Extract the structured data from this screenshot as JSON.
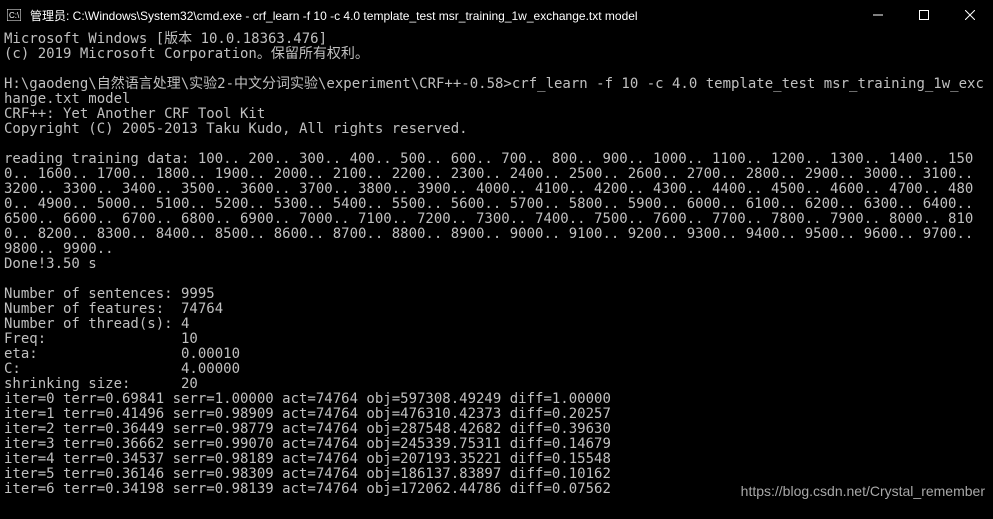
{
  "window": {
    "title": "管理员: C:\\Windows\\System32\\cmd.exe - crf_learn  -f 10 -c 4.0 template_test msr_training_1w_exchange.txt model"
  },
  "terminal": {
    "header": "Microsoft Windows [版本 10.0.18363.476]\n(c) 2019 Microsoft Corporation。保留所有权利。\n\nH:\\gaodeng\\自然语言处理\\实验2-中文分词实验\\experiment\\CRF++-0.58>crf_learn -f 10 -c 4.0 template_test msr_training_1w_exchange.txt model\nCRF++: Yet Another CRF Tool Kit\nCopyright (C) 2005-2013 Taku Kudo, All rights reserved.\n\nreading training data: 100.. 200.. 300.. 400.. 500.. 600.. 700.. 800.. 900.. 1000.. 1100.. 1200.. 1300.. 1400.. 1500.. 1600.. 1700.. 1800.. 1900.. 2000.. 2100.. 2200.. 2300.. 2400.. 2500.. 2600.. 2700.. 2800.. 2900.. 3000.. 3100.. 3200.. 3300.. 3400.. 3500.. 3600.. 3700.. 3800.. 3900.. 4000.. 4100.. 4200.. 4300.. 4400.. 4500.. 4600.. 4700.. 4800.. 4900.. 5000.. 5100.. 5200.. 5300.. 5400.. 5500.. 5600.. 5700.. 5800.. 5900.. 6000.. 6100.. 6200.. 6300.. 6400.. 6500.. 6600.. 6700.. 6800.. 6900.. 7000.. 7100.. 7200.. 7300.. 7400.. 7500.. 7600.. 7700.. 7800.. 7900.. 8000.. 8100.. 8200.. 8300.. 8400.. 8500.. 8600.. 8700.. 8800.. 8900.. 9000.. 9100.. 9200.. 9300.. 9400.. 9500.. 9600.. 9700.. 9800.. 9900..\nDone!3.50 s\n",
    "stats": "Number of sentences: 9995\nNumber of features:  74764\nNumber of thread(s): 4\nFreq:                10\neta:                 0.00010\nC:                   4.00000\nshrinking size:      20",
    "iters": "iter=0 terr=0.69841 serr=1.00000 act=74764 obj=597308.49249 diff=1.00000\niter=1 terr=0.41496 serr=0.98909 act=74764 obj=476310.42373 diff=0.20257\niter=2 terr=0.36449 serr=0.98779 act=74764 obj=287548.42682 diff=0.39630\niter=3 terr=0.36662 serr=0.99070 act=74764 obj=245339.75311 diff=0.14679\niter=4 terr=0.34537 serr=0.98189 act=74764 obj=207193.35221 diff=0.15548\niter=5 terr=0.36146 serr=0.98309 act=74764 obj=186137.83897 diff=0.10162\niter=6 terr=0.34198 serr=0.98139 act=74764 obj=172062.44786 diff=0.07562"
  },
  "watermark": "https://blog.csdn.net/Crystal_remember"
}
